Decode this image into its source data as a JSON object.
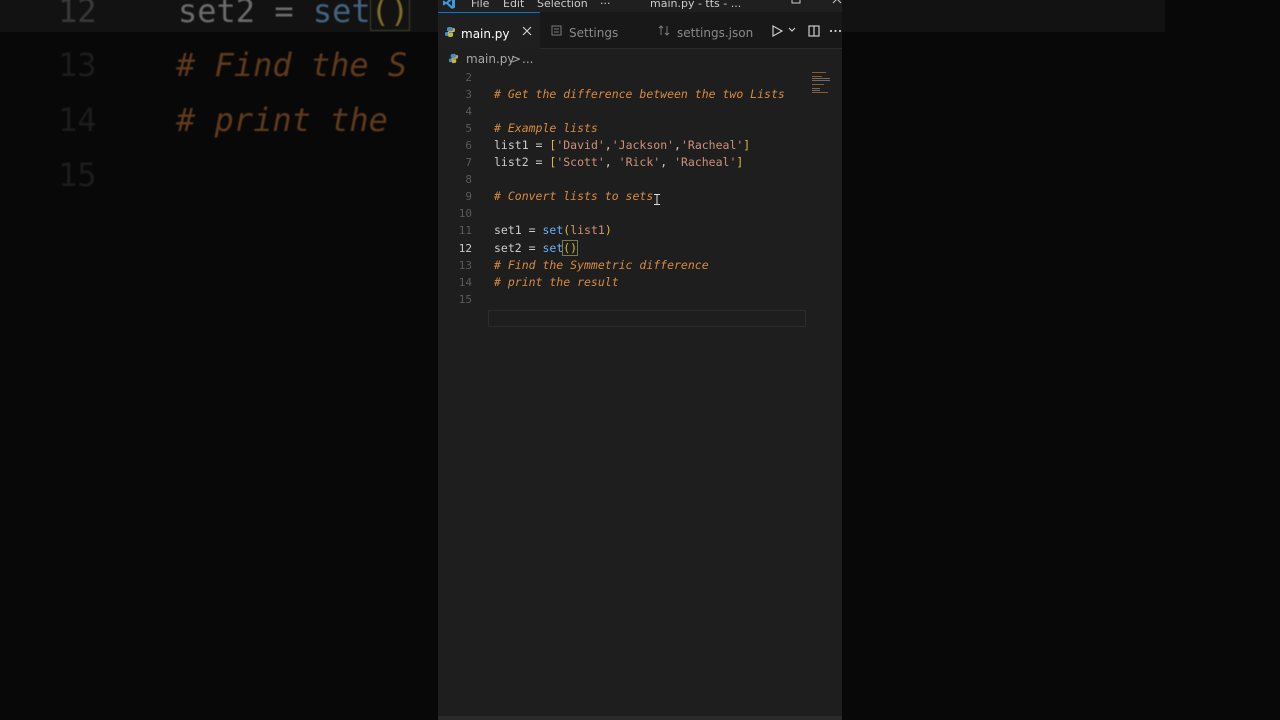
{
  "background_zoom": {
    "numbers": [
      "12",
      "13",
      "14",
      "15"
    ],
    "line12_var": "set2 = ",
    "line12_fn": "set",
    "line12_br": "()",
    "line13": "# Find the S",
    "line14": "# print the"
  },
  "titlebar": {
    "menu": [
      "File",
      "Edit",
      "Selection",
      "···"
    ],
    "title": "main.py - tts - ..."
  },
  "tabs": [
    {
      "label": "main.py",
      "active": true
    },
    {
      "label": "Settings",
      "active": false
    },
    {
      "label": "settings.json",
      "active": false
    }
  ],
  "breadcrumb": {
    "file": "main.py",
    "sep": ">",
    "rest": "..."
  },
  "editor": {
    "current_line": "12",
    "line_numbers": [
      "2",
      "3",
      "4",
      "5",
      "6",
      "7",
      "8",
      "9",
      "10",
      "11",
      "12",
      "13",
      "14",
      "15"
    ],
    "lines": {
      "l3": "# Get the difference between the two Lists",
      "l5": "# Example lists",
      "l6_a": "list1 = ",
      "l6_b": "[",
      "l6_s1": "'David'",
      "l6_c1": ",",
      "l6_s2": "'Jackson'",
      "l6_c2": ",",
      "l6_s3": "'Racheal'",
      "l6_e": "]",
      "l7_a": "list2 = ",
      "l7_b": "[",
      "l7_s1": "'Scott'",
      "l7_c1": ", ",
      "l7_s2": "'Rick'",
      "l7_c2": ", ",
      "l7_s3": "'Racheal'",
      "l7_e": "]",
      "l9": "# Convert lists to sets",
      "l11_a": "set1 = ",
      "l11_fn": "set",
      "l11_b1": "(",
      "l11_arg": "list1",
      "l11_b2": ")",
      "l12_a": "set2 = ",
      "l12_fn": "set",
      "l12_br": "()",
      "l13": "# Find the Symmetric difference",
      "l14": "# print the result"
    }
  }
}
